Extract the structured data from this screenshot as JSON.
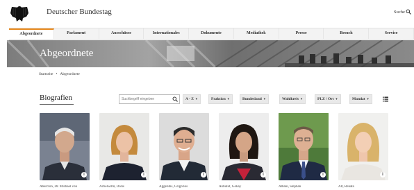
{
  "header": {
    "site_title": "Deutscher Bundestag",
    "search_label": "Suche"
  },
  "nav": {
    "items": [
      {
        "label": "Abgeordnete",
        "active": true
      },
      {
        "label": "Parlament",
        "active": false
      },
      {
        "label": "Ausschüsse",
        "active": false
      },
      {
        "label": "Internationales",
        "active": false
      },
      {
        "label": "Dokumente",
        "active": false
      },
      {
        "label": "Mediathek",
        "active": false
      },
      {
        "label": "Presse",
        "active": false
      },
      {
        "label": "Besuch",
        "active": false
      },
      {
        "label": "Service",
        "active": false
      }
    ]
  },
  "hero": {
    "title": "Abgeordnete"
  },
  "breadcrumb": {
    "home": "Startseite",
    "separator": "•",
    "current": "Abgeordnete"
  },
  "section": {
    "title": "Biografien"
  },
  "search": {
    "placeholder": "Suchbegriff eingeben"
  },
  "filters": {
    "az": "A - Z",
    "fraktion": "Fraktion",
    "bundesland": "Bundesland",
    "wahlkreis": "Wahlkreis",
    "plz_ort": "PLZ / Ort",
    "mandat": "Mandat"
  },
  "cards": [
    {
      "name": "Abercron, Dr. Michael von"
    },
    {
      "name": "Achelwilm, Doris"
    },
    {
      "name": "Aggelidis, Grigorios"
    },
    {
      "name": "Akbulut, Gökay"
    },
    {
      "name": "Albani, Stephan"
    },
    {
      "name": "Alt, Renata"
    }
  ],
  "colors": {
    "accent": "#e8891d",
    "nav_bg": "#f3f3f3",
    "filter_bg": "#e9e9e9"
  }
}
